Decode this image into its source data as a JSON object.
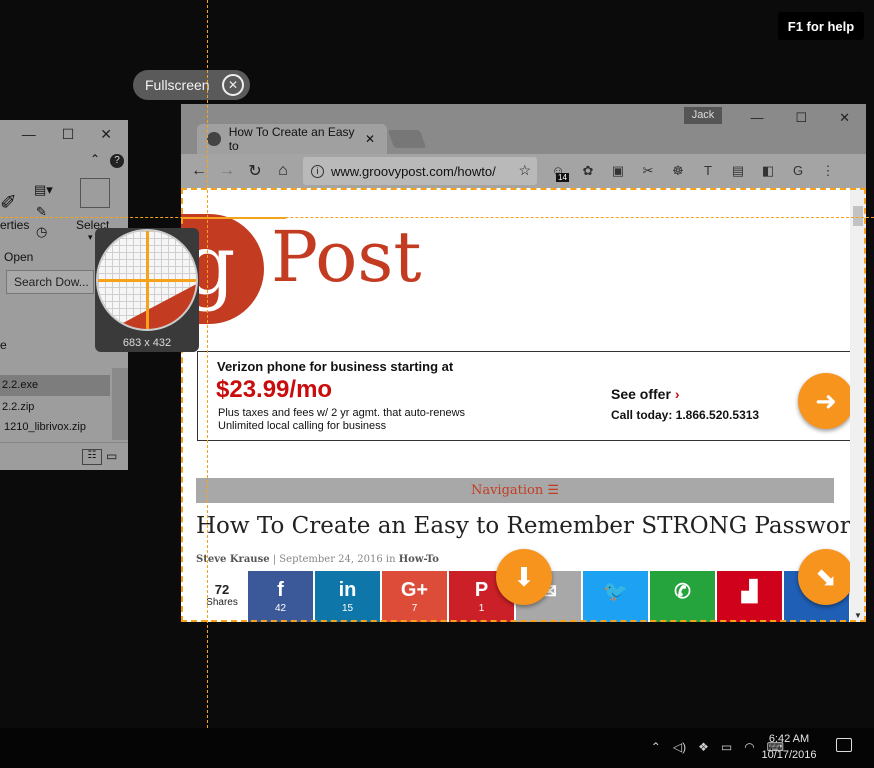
{
  "help": {
    "label": "F1 for help"
  },
  "fullscreen": {
    "label": "Fullscreen"
  },
  "explorer": {
    "ribbon_labels": {
      "properties": "erties",
      "select": "Select",
      "open": "Open"
    },
    "search_placeholder": "Search Dow...",
    "files": [
      "2.2.exe",
      "2.2.zip",
      "1210_librivox.zip"
    ],
    "side_item": "e"
  },
  "browser": {
    "profile": "Jack",
    "tab_title": "How To Create an Easy to",
    "url": "www.groovypost.com/howto/",
    "ext_badge": "14"
  },
  "page": {
    "logo_g": "g",
    "logo_post": "Post",
    "ad": {
      "line1": "Verizon phone for business starting at",
      "price": "$23.99/mo",
      "line3": "Plus taxes and fees w/ 2 yr agmt. that auto-renews",
      "line4": "Unlimited local calling for business",
      "see_offer": "See offer",
      "call": "Call today: 1.866.520.5313"
    },
    "navigation": "Navigation",
    "article_title": "How To Create an Easy to Remember STRONG Password",
    "meta": {
      "author": "Steve Krause",
      "date": "September 24, 2016",
      "in": "in",
      "category": "How-To"
    },
    "shares": {
      "count": "72",
      "label": "Shares"
    },
    "share_buttons": [
      {
        "name": "facebook",
        "icon": "f",
        "count": "42",
        "color": "#3b5998"
      },
      {
        "name": "linkedin",
        "icon": "in",
        "count": "15",
        "color": "#0e76a8"
      },
      {
        "name": "googleplus",
        "icon": "G+",
        "count": "7",
        "color": "#dd4b39"
      },
      {
        "name": "pinterest",
        "icon": "P",
        "count": "1",
        "color": "#cb2027"
      },
      {
        "name": "email",
        "icon": "✉",
        "count": "",
        "color": "#a8a8a8"
      },
      {
        "name": "twitter",
        "icon": "🐦",
        "count": "",
        "color": "#1da1f2"
      },
      {
        "name": "whatsapp",
        "icon": "✆",
        "count": "",
        "color": "#25a33c"
      },
      {
        "name": "flipboard",
        "icon": "▟",
        "count": "",
        "color": "#d0021b"
      },
      {
        "name": "more",
        "icon": "+",
        "count": "",
        "color": "#1f5fb5"
      }
    ]
  },
  "magnifier": {
    "dimensions": "683 x 432"
  },
  "taskbar": {
    "time": "6:42 AM",
    "date": "10/17/2016"
  }
}
